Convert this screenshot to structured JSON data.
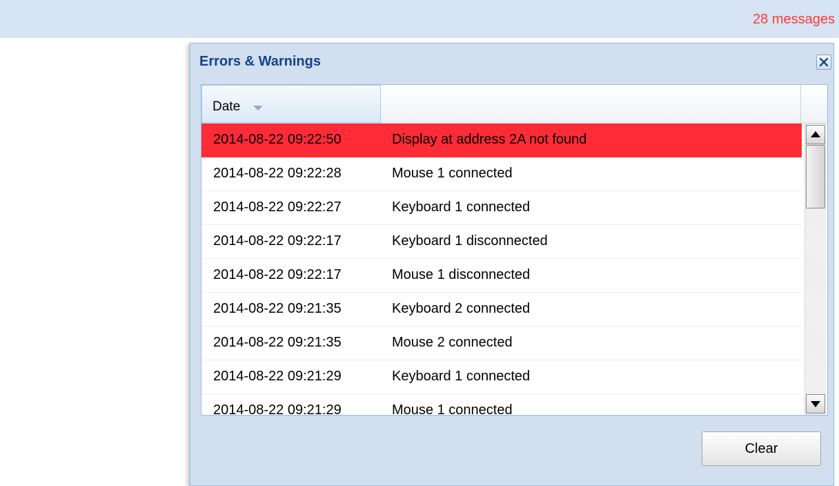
{
  "topbar": {
    "message_count": "28 messages"
  },
  "dialog": {
    "title": "Errors & Warnings",
    "close_icon": "close-icon",
    "grid": {
      "columns": [
        "Date",
        ""
      ],
      "sort": {
        "column": "Date",
        "direction": "descending"
      },
      "rows": [
        {
          "date": "2014-08-22 09:22:50",
          "message": "Display at address 2A not found",
          "level": "error"
        },
        {
          "date": "2014-08-22 09:22:28",
          "message": "Mouse 1 connected",
          "level": "info"
        },
        {
          "date": "2014-08-22 09:22:27",
          "message": "Keyboard 1 connected",
          "level": "info"
        },
        {
          "date": "2014-08-22 09:22:17",
          "message": "Keyboard 1 disconnected",
          "level": "info"
        },
        {
          "date": "2014-08-22 09:22:17",
          "message": "Mouse 1 disconnected",
          "level": "info"
        },
        {
          "date": "2014-08-22 09:21:35",
          "message": "Keyboard 2 connected",
          "level": "info"
        },
        {
          "date": "2014-08-22 09:21:35",
          "message": "Mouse 2 connected",
          "level": "info"
        },
        {
          "date": "2014-08-22 09:21:29",
          "message": "Keyboard 1 connected",
          "level": "info"
        },
        {
          "date": "2014-08-22 09:21:29",
          "message": "Mouse 1 connected",
          "level": "info"
        }
      ]
    },
    "clear_label": "Clear"
  },
  "colors": {
    "topbar_bg": "#d6e3f2",
    "message_count": "#ff3b3b",
    "title": "#15428b",
    "error_row": "#ff2b36",
    "dialog_bg": "#d1dfee"
  }
}
